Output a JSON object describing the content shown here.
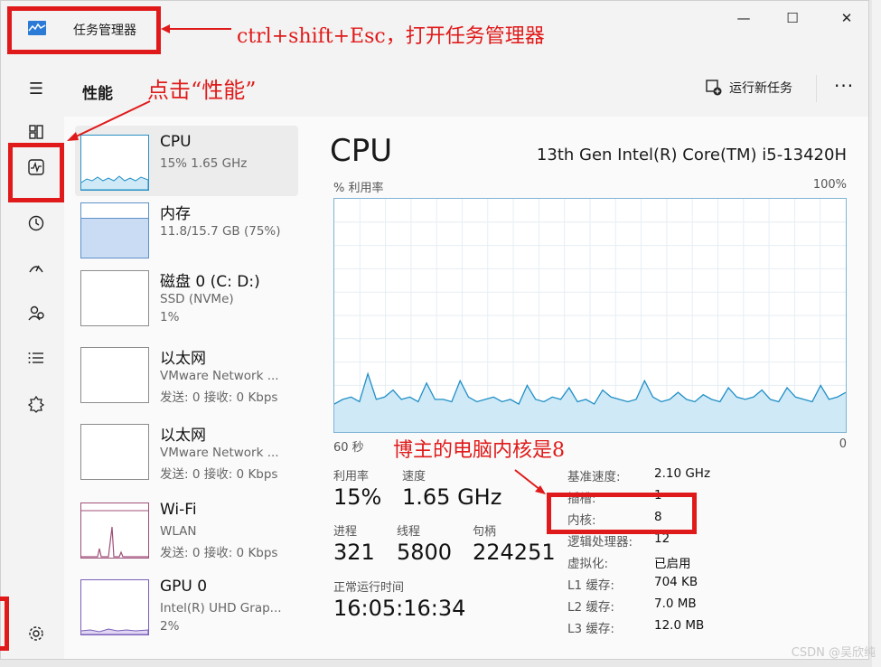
{
  "window": {
    "title": "任务管理器",
    "minimize_icon": "minimize-icon",
    "maximize_icon": "maximize-icon",
    "close_icon": "close-icon"
  },
  "header": {
    "page_title": "性能",
    "run_task_label": "运行新任务",
    "more_label": "···"
  },
  "nav": {
    "items": [
      "hamburger-icon",
      "processes-icon",
      "performance-icon",
      "app-history-icon",
      "startup-icon",
      "users-icon",
      "details-icon",
      "services-icon",
      "settings-icon"
    ]
  },
  "list": [
    {
      "name": "CPU",
      "sub1": "15% 1.65 GHz",
      "sub2": ""
    },
    {
      "name": "内存",
      "sub1": "11.8/15.7 GB (75%)",
      "sub2": ""
    },
    {
      "name": "磁盘 0 (C: D:)",
      "sub1": "SSD (NVMe)",
      "sub2": "1%"
    },
    {
      "name": "以太网",
      "sub1": "VMware Network ...",
      "sub2": "发送: 0 接收: 0 Kbps"
    },
    {
      "name": "以太网",
      "sub1": "VMware Network ...",
      "sub2": "发送: 0 接收: 0 Kbps"
    },
    {
      "name": "Wi-Fi",
      "sub1": "WLAN",
      "sub2": "发送: 0 接收: 0 Kbps"
    },
    {
      "name": "GPU 0",
      "sub1": "Intel(R) UHD Grap...",
      "sub2": "2%"
    }
  ],
  "detail": {
    "title": "CPU",
    "model": "13th Gen Intel(R) Core(TM) i5-13420H",
    "graph_ylabel": "% 利用率",
    "graph_ymax": "100%",
    "graph_xstart": "60 秒",
    "graph_xend": "0",
    "stats": {
      "util_label": "利用率",
      "util_value": "15%",
      "speed_label": "速度",
      "speed_value": "1.65 GHz",
      "proc_label": "进程",
      "proc_value": "321",
      "thread_label": "线程",
      "thread_value": "5800",
      "handle_label": "句柄",
      "handle_value": "224251",
      "uptime_label": "正常运行时间",
      "uptime_value": "16:05:16:34"
    },
    "specs": [
      {
        "k": "基准速度:",
        "v": "2.10 GHz"
      },
      {
        "k": "插槽:",
        "v": "1"
      },
      {
        "k": "内核:",
        "v": "8"
      },
      {
        "k": "逻辑处理器:",
        "v": "12"
      },
      {
        "k": "虚拟化:",
        "v": "已启用"
      },
      {
        "k": "L1 缓存:",
        "v": "704 KB"
      },
      {
        "k": "L2 缓存:",
        "v": "7.0 MB"
      },
      {
        "k": "L3 缓存:",
        "v": "12.0 MB"
      }
    ]
  },
  "cpu_history": [
    12,
    14,
    15,
    13,
    25,
    14,
    15,
    18,
    14,
    15,
    13,
    21,
    14,
    14,
    13,
    22,
    15,
    13,
    14,
    15,
    13,
    14,
    12,
    20,
    14,
    13,
    15,
    14,
    19,
    13,
    14,
    12,
    18,
    15,
    14,
    13,
    14,
    22,
    15,
    13,
    14,
    17,
    14,
    13,
    16,
    14,
    13,
    19,
    15,
    14,
    15,
    18,
    14,
    13,
    19,
    15,
    14,
    13,
    20,
    14,
    15,
    17
  ],
  "annotations": {
    "title_note": "ctrl+shift+Esc，打开任务管理器",
    "perf_note": "点击“性能”",
    "cores_note": "博主的电脑内核是8"
  },
  "colors": {
    "annotation": "#e01a1a",
    "graph_line": "#1f8fc7",
    "graph_fill": "#cfe9f6"
  },
  "watermark": "CSDN @吴欣纯"
}
